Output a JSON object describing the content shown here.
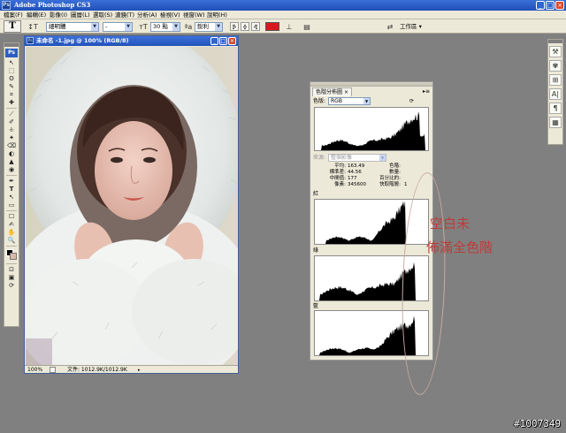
{
  "window": {
    "title": "Adobe Photoshop CS3",
    "minimize": "_",
    "restore": "□",
    "close": "×"
  },
  "menu": [
    "檔案(F)",
    "編輯(E)",
    "影像(I)",
    "圖層(L)",
    "選取(S)",
    "濾鏡(T)",
    "分析(A)",
    "檢視(V)",
    "視窗(W)",
    "說明(H)"
  ],
  "options": {
    "tool_glyph": "T",
    "orient_glyph": "↕T",
    "font_family": "細明體",
    "font_style": "-",
    "font_size": "30 點",
    "anti_alias": "銳利",
    "text_color": "#d8181f",
    "warp_glyph": "⊥",
    "panels_glyph": "▤",
    "workspace": "工作區 ▾",
    "bridge_glyph": "⇄"
  },
  "toolbox": {
    "logo": "Ps",
    "tools": [
      "↖",
      "⬚",
      "ʘ",
      "✎",
      "⌗",
      "✚",
      "⟋",
      "✐",
      "⎀",
      "✦",
      "⌫",
      "◐",
      "▲",
      "◉",
      "✒",
      "T",
      "↖",
      "▭",
      "☐",
      "✍",
      "✋",
      "🔍"
    ],
    "bottom": [
      "⊡",
      "▣",
      "⟳"
    ],
    "fg_color": "#000000",
    "bg_color": "#d9b9aa"
  },
  "rightwell": [
    "⚒",
    "✾",
    "⊞",
    "A|",
    "¶",
    "▦"
  ],
  "document": {
    "title": "未命名 -1.jpg @ 100% (RGB/8)",
    "zoom": "100%",
    "status": "文件: 1012.9K/1012.9K"
  },
  "histogram": {
    "tab": "色階分佈圖",
    "menu_glyph": "▸≡",
    "channel_label": "色版:",
    "channel_value": "RGB",
    "source_label": "來源:",
    "source_value": "整個影像",
    "refresh_glyph": "⟳",
    "stats_left": [
      {
        "label": "平均:",
        "value": "163.49"
      },
      {
        "label": "標準差:",
        "value": "44.56"
      },
      {
        "label": "中間值:",
        "value": "177"
      },
      {
        "label": "像素:",
        "value": "345600"
      }
    ],
    "stats_right": [
      {
        "label": "色階:",
        "value": ""
      },
      {
        "label": "數量:",
        "value": ""
      },
      {
        "label": "百分比的:",
        "value": ""
      },
      {
        "label": "快取階層:",
        "value": "1"
      }
    ],
    "channels": [
      "紅",
      "綠",
      "藍"
    ]
  },
  "annotations": {
    "line1": "空白未",
    "line2": "佈滿全色階"
  },
  "watermark": "#1007349"
}
